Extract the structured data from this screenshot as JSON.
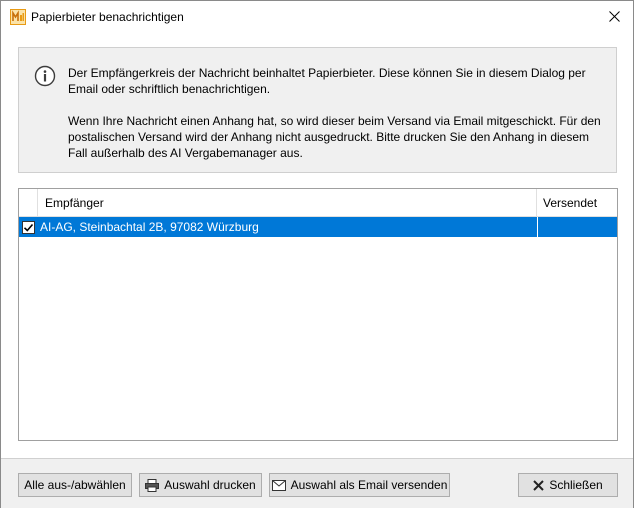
{
  "window": {
    "title": "Papierbieter benachrichtigen"
  },
  "info": {
    "paragraph1": "Der Empfängerkreis der Nachricht beinhaltet Papierbieter. Diese können Sie in diesem Dialog per Email oder schriftlich benachrichtigen.",
    "paragraph2": "Wenn Ihre Nachricht einen Anhang hat, so wird dieser beim Versand via Email mitgeschickt. Für den postalischen Versand wird der Anhang nicht ausgedruckt. Bitte drucken Sie den Anhang in diesem Fall außerhalb des AI Vergabemanager aus."
  },
  "table": {
    "columns": {
      "recipient": "Empfänger",
      "sent": "Versendet"
    },
    "rows": [
      {
        "checked": true,
        "recipient": "AI-AG, Steinbachtal 2B, 97082 Würzburg",
        "sent": ""
      }
    ]
  },
  "footer": {
    "toggle_all_label": "Alle aus-/abwählen",
    "print_label": "Auswahl drucken",
    "email_label": "Auswahl als Email versenden",
    "close_label": "Schließen"
  },
  "icons": {
    "app": "app-logo-icon",
    "close": "close-icon",
    "info": "info-icon",
    "checkbox": "checkmark-icon",
    "print": "printer-icon",
    "email": "envelope-icon",
    "close_button": "x-icon"
  },
  "colors": {
    "selection": "#0078d7",
    "panel": "#f0f0f0",
    "app_icon": "#f5a623"
  }
}
